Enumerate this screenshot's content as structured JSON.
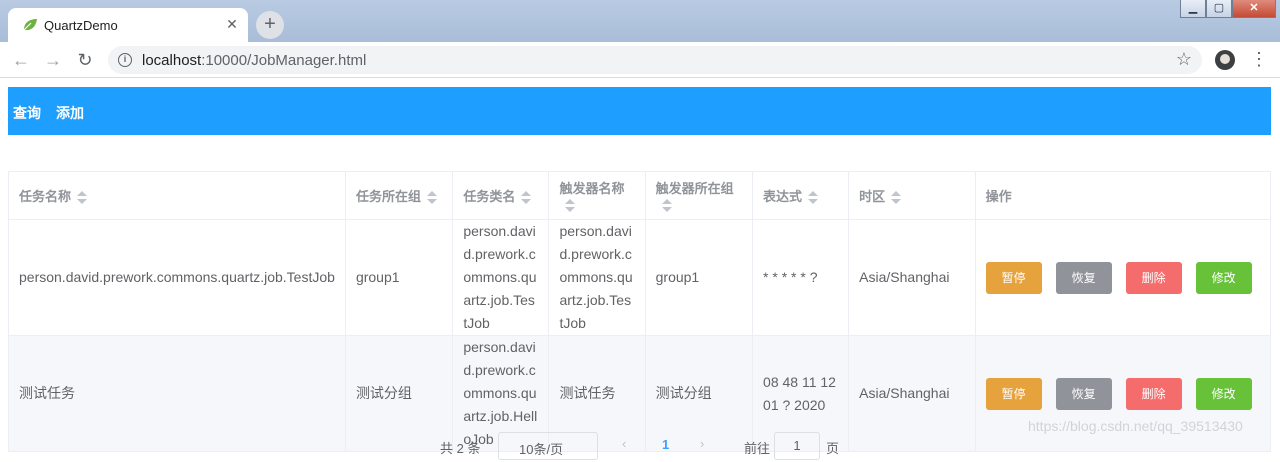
{
  "browser": {
    "tab_title": "QuartzDemo",
    "url_host": "localhost",
    "url_path": ":10000/JobManager.html",
    "icons": [
      "leaf-favicon-icon",
      "close-icon",
      "plus-icon",
      "back-arrow-icon",
      "forward-arrow-icon",
      "reload-icon",
      "info-icon",
      "star-icon",
      "avatar",
      "kebab-menu-icon"
    ]
  },
  "nav": {
    "query": "查询",
    "add": "添加"
  },
  "table": {
    "headers": [
      "任务名称",
      "任务所在组",
      "任务类名",
      "触发器名称",
      "触发器所在组",
      "表达式",
      "时区",
      "操作"
    ],
    "rows": [
      {
        "job_name": "person.david.prework.commons.quartz.job.TestJob",
        "job_group": "group1",
        "job_class": "person.david.prework.commons.quartz.job.TestJob",
        "trigger_name": "person.david.prework.commons.quartz.job.TestJob",
        "trigger_group": "group1",
        "cron": "* * * * * ?",
        "timezone": "Asia/Shanghai"
      },
      {
        "job_name": "测试任务",
        "job_group": "测试分组",
        "job_class": "person.david.prework.commons.quartz.job.HelloJob",
        "trigger_name": "测试任务",
        "trigger_group": "测试分组",
        "cron": "08 48 11 12 01 ? 2020",
        "timezone": "Asia/Shanghai"
      }
    ],
    "actions": {
      "pause": "暂停",
      "resume": "恢复",
      "delete": "删除",
      "edit": "修改"
    },
    "colors": {
      "pause": "#e6a23c",
      "resume": "#909399",
      "delete": "#f56c6c",
      "edit": "#67c23a"
    }
  },
  "pagination": {
    "total": "共 2 条",
    "page_size": "10条/页",
    "prev": "‹",
    "current": "1",
    "next": "›",
    "goto_prefix": "前往",
    "goto_value": "1",
    "goto_suffix": "页"
  },
  "watermark": "https://blog.csdn.net/qq_39513430",
  "accent_color": "#1e9fff"
}
